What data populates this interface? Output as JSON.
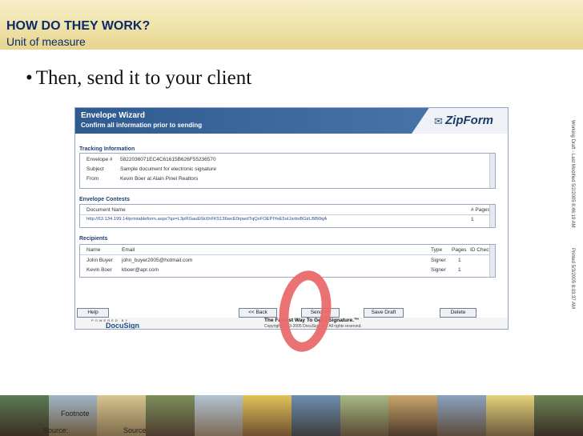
{
  "slide": {
    "title": "HOW DO THEY WORK?",
    "subtitle": "Unit of measure",
    "bullet_dot": "•",
    "bullet": "Then, send it to your client",
    "side_text": {
      "draft": "Working Draft - Last Modified 5/2/2005 8:46:19 AM",
      "printed": "Printed 5/3/2005 8:03:37 AM"
    },
    "footer": {
      "footnote": "Footnote",
      "source1": "Source:",
      "source2": "Source"
    }
  },
  "wizard": {
    "title": "Envelope Wizard",
    "subtitle": "Confirm all information prior to sending",
    "logo": "ZipForm",
    "tracking": {
      "label": "Tracking Information",
      "rows": [
        {
          "k": "Envelope #",
          "v": "5822036071EC4C61615B626F55236570"
        },
        {
          "k": "Subject",
          "v": "Sample document for electronic signature"
        },
        {
          "k": "From",
          "v": "Kevin Boer at Alain Pinel Realtors"
        }
      ]
    },
    "contents": {
      "label": "Envelope Contests",
      "col_name": "Document Name",
      "col_pages": "# Pages",
      "doc_url": "http://63.134.199.14/printableform.aspx?qs=L3pRGauE6kXhFK5136wcE0rpwdTqQxFOEPIYeE5oIJsrbvBGirLBB0kjA",
      "doc_pages": "1"
    },
    "recipients": {
      "label": "Recipients",
      "headers": [
        "Name",
        "Email",
        "Type",
        "Pages",
        "ID Check"
      ],
      "rows": [
        {
          "name": "John Buyer",
          "email": "john_buyer2005@hotmail.com",
          "type": "Signer",
          "pages": "1"
        },
        {
          "name": "Kevin Boer",
          "email": "kboer@apr.com",
          "type": "Signer",
          "pages": "1"
        }
      ]
    },
    "buttons": {
      "help": "Help",
      "back": "<< Back",
      "send": "Send >>",
      "save": "Save Draft",
      "delete": "Delete"
    },
    "brand": {
      "powered": "POWERED BY",
      "docusign": "DocuSign",
      "tagline": "The Fastest Way To Get a Signature.™",
      "copyright": "Copyright 2003-2005 DocuSign Inc. All rights reserved."
    }
  },
  "colors": {
    "title": "#0c2a68",
    "wizard_header": "#2f5a8f",
    "highlight_circle": "#e96a6a"
  }
}
